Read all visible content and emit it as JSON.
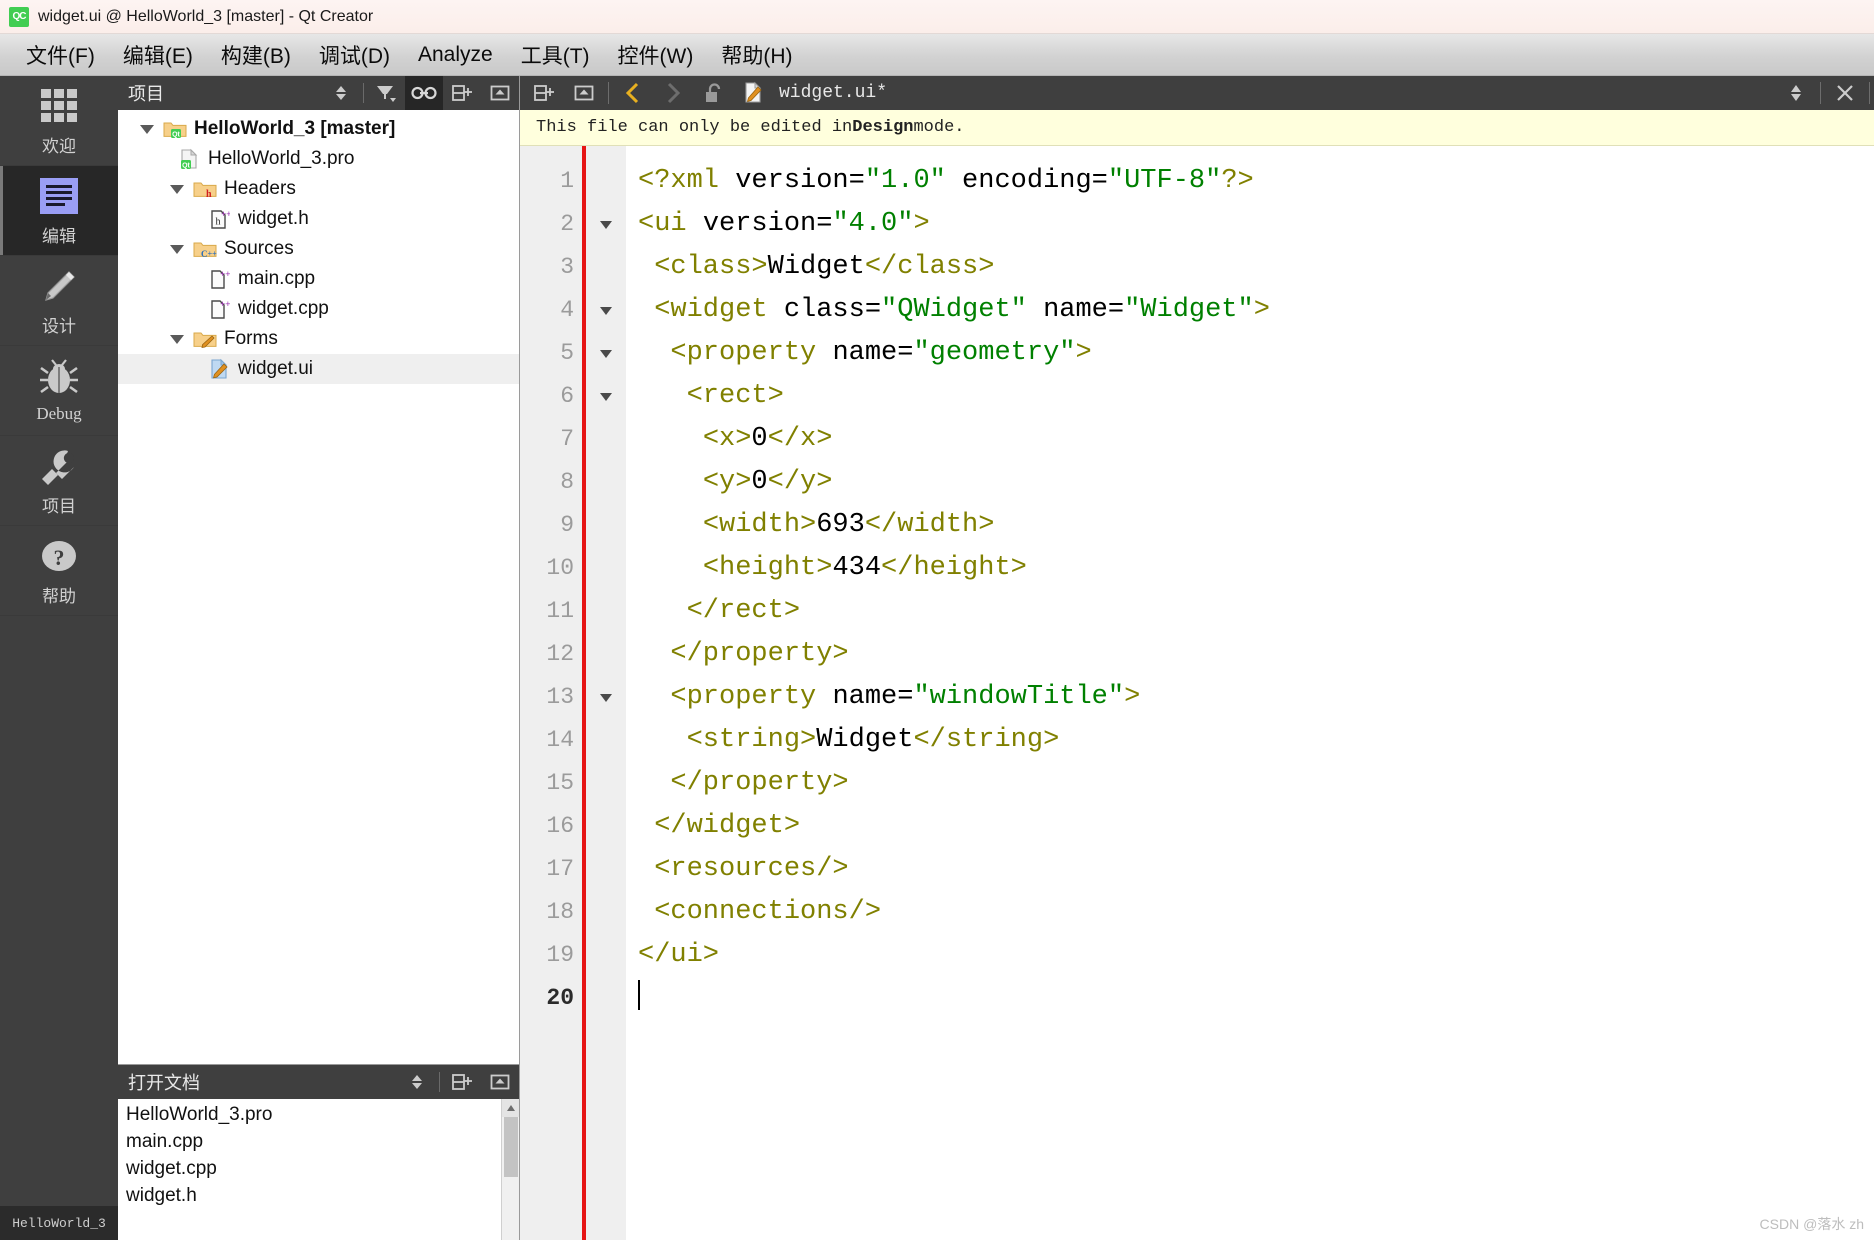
{
  "window": {
    "title": "widget.ui @ HelloWorld_3 [master] - Qt Creator",
    "logo_text": "QC"
  },
  "menubar": {
    "items": [
      {
        "label": "文件(F)",
        "mnemonic": "F"
      },
      {
        "label": "编辑(E)",
        "mnemonic": "E"
      },
      {
        "label": "构建(B)",
        "mnemonic": "B"
      },
      {
        "label": "调试(D)",
        "mnemonic": "D"
      },
      {
        "label": "Analyze",
        "mnemonic": "A"
      },
      {
        "label": "工具(T)",
        "mnemonic": "T"
      },
      {
        "label": "控件(W)",
        "mnemonic": "W"
      },
      {
        "label": "帮助(H)",
        "mnemonic": "H"
      }
    ]
  },
  "modebar": {
    "items": [
      {
        "label": "欢迎",
        "icon": "grid-icon",
        "active": false
      },
      {
        "label": "编辑",
        "icon": "edit-lines-icon",
        "active": true
      },
      {
        "label": "设计",
        "icon": "pencil-icon",
        "active": false
      },
      {
        "label": "Debug",
        "icon": "bug-icon",
        "active": false
      },
      {
        "label": "项目",
        "icon": "wrench-icon",
        "active": false
      },
      {
        "label": "帮助",
        "icon": "question-mark-icon",
        "active": false
      }
    ],
    "footer": "HelloWorld_3"
  },
  "project_panel": {
    "title": "项目",
    "buttons": [
      {
        "name": "sync-dropdown",
        "icon": "up-down-arrows-icon",
        "active": false
      },
      {
        "name": "filter",
        "icon": "funnel-icon",
        "active": false
      },
      {
        "name": "link-with-editor",
        "icon": "link-icon",
        "active": true
      },
      {
        "name": "split",
        "icon": "split-add-icon",
        "active": false
      },
      {
        "name": "maximize",
        "icon": "maximize-icon",
        "active": false
      }
    ],
    "tree": [
      {
        "label": "HelloWorld_3 [master]",
        "indent": 0,
        "expanded": true,
        "icon": "qt-folder-icon",
        "bold": true,
        "selected": false
      },
      {
        "label": "HelloWorld_3.pro",
        "indent": 1,
        "expanded": null,
        "icon": "qt-file-icon",
        "bold": false,
        "selected": false
      },
      {
        "label": "Headers",
        "indent": 1,
        "expanded": true,
        "icon": "h-folder-icon",
        "bold": false,
        "selected": false
      },
      {
        "label": "widget.h",
        "indent": 2,
        "expanded": null,
        "icon": "h-file-icon",
        "bold": false,
        "selected": false
      },
      {
        "label": "Sources",
        "indent": 1,
        "expanded": true,
        "icon": "cpp-folder-icon",
        "bold": false,
        "selected": false
      },
      {
        "label": "main.cpp",
        "indent": 2,
        "expanded": null,
        "icon": "cpp-file-icon",
        "bold": false,
        "selected": false
      },
      {
        "label": "widget.cpp",
        "indent": 2,
        "expanded": null,
        "icon": "cpp-file-icon",
        "bold": false,
        "selected": false
      },
      {
        "label": "Forms",
        "indent": 1,
        "expanded": true,
        "icon": "ui-folder-icon",
        "bold": false,
        "selected": false
      },
      {
        "label": "widget.ui",
        "indent": 2,
        "expanded": null,
        "icon": "ui-file-icon",
        "bold": false,
        "selected": true
      }
    ]
  },
  "open_documents": {
    "title": "打开文档",
    "buttons": [
      {
        "name": "sort-dropdown",
        "icon": "up-down-arrows-icon"
      },
      {
        "name": "split",
        "icon": "split-add-icon"
      },
      {
        "name": "maximize",
        "icon": "maximize-icon"
      }
    ],
    "items": [
      "HelloWorld_3.pro",
      "main.cpp",
      "widget.cpp",
      "widget.h"
    ]
  },
  "editor": {
    "tab_label": "widget.ui*",
    "toolbar": [
      {
        "name": "navigate-back",
        "icon": "chevron-left-icon",
        "enabled": true
      },
      {
        "name": "navigate-forward",
        "icon": "chevron-right-icon",
        "enabled": false
      },
      {
        "name": "lock-toggle",
        "icon": "unlock-icon",
        "enabled": true
      },
      {
        "name": "file-type",
        "icon": "ui-file-icon",
        "enabled": false
      }
    ],
    "right_buttons": [
      {
        "name": "document-list-dropdown",
        "icon": "up-down-arrows-icon"
      },
      {
        "name": "close-document",
        "icon": "close-x-icon"
      }
    ],
    "info_bar": {
      "prefix": "This file can only be edited in ",
      "emphasis": "Design",
      "suffix": " mode."
    },
    "current_line": 20,
    "lines": [
      {
        "n": 1,
        "fold": false,
        "tokens": [
          {
            "t": "tag",
            "v": "<?xml "
          },
          {
            "t": "attr",
            "v": "version="
          },
          {
            "t": "val",
            "v": "\"1.0\""
          },
          {
            "t": "attr",
            "v": " encoding="
          },
          {
            "t": "val",
            "v": "\"UTF-8\""
          },
          {
            "t": "tag",
            "v": "?>"
          }
        ]
      },
      {
        "n": 2,
        "fold": true,
        "tokens": [
          {
            "t": "tag",
            "v": "<ui "
          },
          {
            "t": "attr",
            "v": "version="
          },
          {
            "t": "val",
            "v": "\"4.0\""
          },
          {
            "t": "tag",
            "v": ">"
          }
        ]
      },
      {
        "n": 3,
        "fold": false,
        "tokens": [
          {
            "t": "txt",
            "v": " "
          },
          {
            "t": "tag",
            "v": "<class>"
          },
          {
            "t": "txt",
            "v": "Widget"
          },
          {
            "t": "tag",
            "v": "</class>"
          }
        ]
      },
      {
        "n": 4,
        "fold": true,
        "tokens": [
          {
            "t": "txt",
            "v": " "
          },
          {
            "t": "tag",
            "v": "<widget "
          },
          {
            "t": "attr",
            "v": "class="
          },
          {
            "t": "val",
            "v": "\"QWidget\""
          },
          {
            "t": "attr",
            "v": " name="
          },
          {
            "t": "val",
            "v": "\"Widget\""
          },
          {
            "t": "tag",
            "v": ">"
          }
        ]
      },
      {
        "n": 5,
        "fold": true,
        "tokens": [
          {
            "t": "txt",
            "v": "  "
          },
          {
            "t": "tag",
            "v": "<property "
          },
          {
            "t": "attr",
            "v": "name="
          },
          {
            "t": "val",
            "v": "\"geometry\""
          },
          {
            "t": "tag",
            "v": ">"
          }
        ]
      },
      {
        "n": 6,
        "fold": true,
        "tokens": [
          {
            "t": "txt",
            "v": "   "
          },
          {
            "t": "tag",
            "v": "<rect>"
          }
        ]
      },
      {
        "n": 7,
        "fold": false,
        "tokens": [
          {
            "t": "txt",
            "v": "    "
          },
          {
            "t": "tag",
            "v": "<x>"
          },
          {
            "t": "txt",
            "v": "0"
          },
          {
            "t": "tag",
            "v": "</x>"
          }
        ]
      },
      {
        "n": 8,
        "fold": false,
        "tokens": [
          {
            "t": "txt",
            "v": "    "
          },
          {
            "t": "tag",
            "v": "<y>"
          },
          {
            "t": "txt",
            "v": "0"
          },
          {
            "t": "tag",
            "v": "</y>"
          }
        ]
      },
      {
        "n": 9,
        "fold": false,
        "tokens": [
          {
            "t": "txt",
            "v": "    "
          },
          {
            "t": "tag",
            "v": "<width>"
          },
          {
            "t": "txt",
            "v": "693"
          },
          {
            "t": "tag",
            "v": "</width>"
          }
        ]
      },
      {
        "n": 10,
        "fold": false,
        "tokens": [
          {
            "t": "txt",
            "v": "    "
          },
          {
            "t": "tag",
            "v": "<height>"
          },
          {
            "t": "txt",
            "v": "434"
          },
          {
            "t": "tag",
            "v": "</height>"
          }
        ]
      },
      {
        "n": 11,
        "fold": false,
        "tokens": [
          {
            "t": "txt",
            "v": "   "
          },
          {
            "t": "tag",
            "v": "</rect>"
          }
        ]
      },
      {
        "n": 12,
        "fold": false,
        "tokens": [
          {
            "t": "txt",
            "v": "  "
          },
          {
            "t": "tag",
            "v": "</property>"
          }
        ]
      },
      {
        "n": 13,
        "fold": true,
        "tokens": [
          {
            "t": "txt",
            "v": "  "
          },
          {
            "t": "tag",
            "v": "<property "
          },
          {
            "t": "attr",
            "v": "name="
          },
          {
            "t": "val",
            "v": "\"windowTitle\""
          },
          {
            "t": "tag",
            "v": ">"
          }
        ]
      },
      {
        "n": 14,
        "fold": false,
        "tokens": [
          {
            "t": "txt",
            "v": "   "
          },
          {
            "t": "tag",
            "v": "<string>"
          },
          {
            "t": "txt",
            "v": "Widget"
          },
          {
            "t": "tag",
            "v": "</string>"
          }
        ]
      },
      {
        "n": 15,
        "fold": false,
        "tokens": [
          {
            "t": "txt",
            "v": "  "
          },
          {
            "t": "tag",
            "v": "</property>"
          }
        ]
      },
      {
        "n": 16,
        "fold": false,
        "tokens": [
          {
            "t": "txt",
            "v": " "
          },
          {
            "t": "tag",
            "v": "</widget>"
          }
        ]
      },
      {
        "n": 17,
        "fold": false,
        "tokens": [
          {
            "t": "txt",
            "v": " "
          },
          {
            "t": "tag",
            "v": "<resources/>"
          }
        ]
      },
      {
        "n": 18,
        "fold": false,
        "tokens": [
          {
            "t": "txt",
            "v": " "
          },
          {
            "t": "tag",
            "v": "<connections/>"
          }
        ]
      },
      {
        "n": 19,
        "fold": false,
        "tokens": [
          {
            "t": "tag",
            "v": "</ui>"
          }
        ]
      },
      {
        "n": 20,
        "fold": false,
        "tokens": [],
        "cursor": true
      }
    ]
  },
  "watermark": "CSDN @落水 zh",
  "colors": {
    "tag": "#808000",
    "attr": "#000000",
    "string_value": "#008000",
    "accent_qt_green": "#41cd52",
    "modified_marker": "#e61515",
    "info_bar_bg": "#ffffdd",
    "dock_bg": "#3f3f3f",
    "selection": "#efefef"
  }
}
